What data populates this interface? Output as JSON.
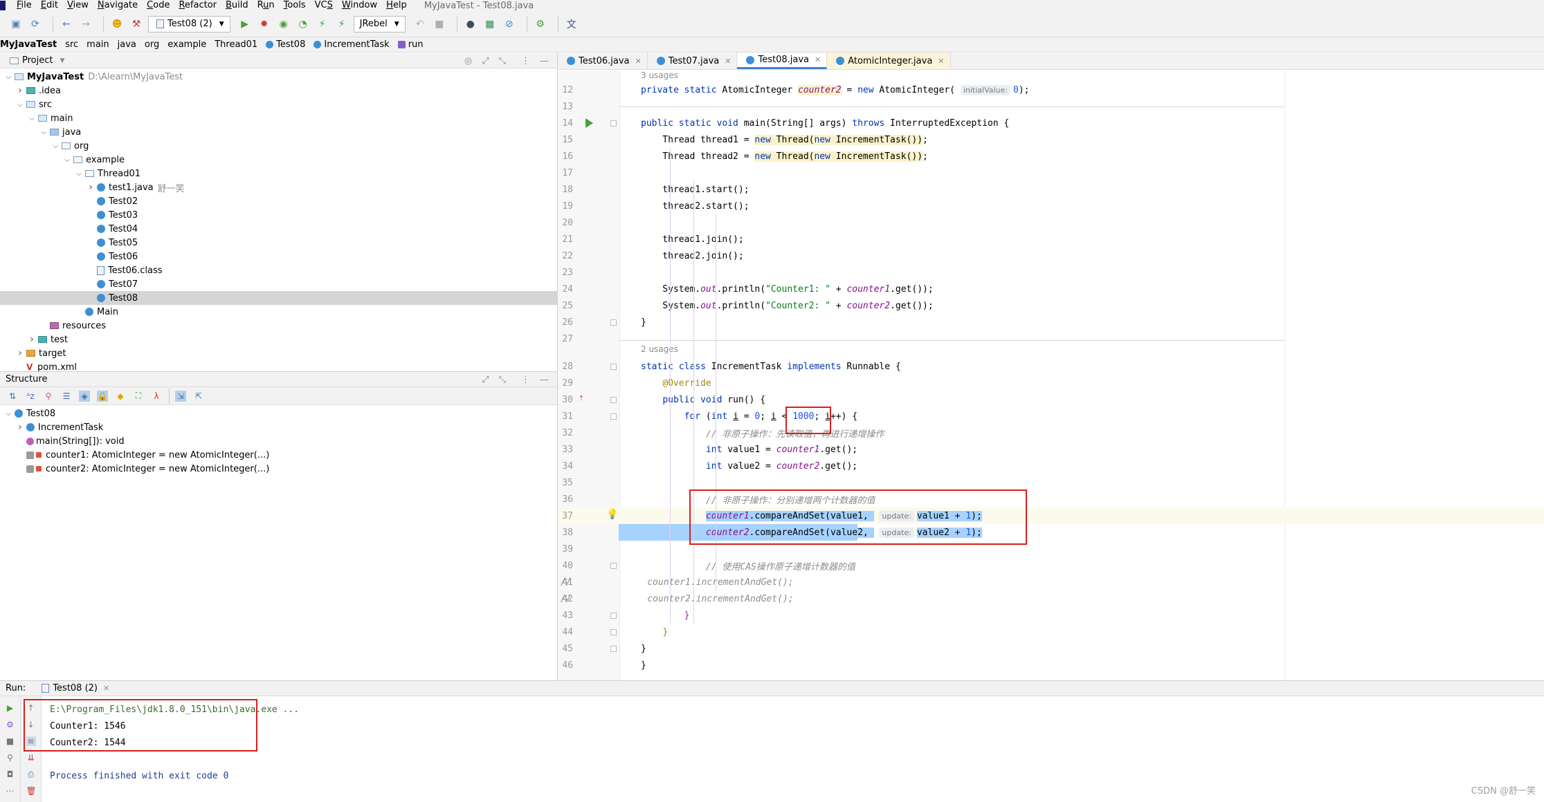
{
  "menubar": {
    "items": [
      "File",
      "Edit",
      "View",
      "Navigate",
      "Code",
      "Refactor",
      "Build",
      "Run",
      "Tools",
      "VCS",
      "Window",
      "Help"
    ],
    "mnemonics": [
      "F",
      "E",
      "V",
      "N",
      "C",
      "R",
      "B",
      "u",
      "T",
      "S",
      "W",
      "H"
    ],
    "window_title": "MyJavaTest - Test08.java"
  },
  "toolbar": {
    "run_config": "Test08 (2)",
    "jrebel": "JRebel"
  },
  "breadcrumb": [
    "MyJavaTest",
    "src",
    "main",
    "java",
    "org",
    "example",
    "Thread01",
    "Test08",
    "IncrementTask",
    "run"
  ],
  "project_panel": {
    "title": "Project",
    "tree": [
      {
        "label": "MyJavaTest",
        "extra": "D:\\Alearn\\MyJavaTest",
        "depth": 0,
        "toggle": "open",
        "icon": "folder",
        "bold": true
      },
      {
        "label": ".idea",
        "depth": 1,
        "toggle": "closed",
        "icon": "folder-teal"
      },
      {
        "label": "src",
        "depth": 1,
        "toggle": "open",
        "icon": "folder"
      },
      {
        "label": "main",
        "depth": 2,
        "toggle": "open",
        "icon": "folder"
      },
      {
        "label": "java",
        "depth": 3,
        "toggle": "open",
        "icon": "folder-src"
      },
      {
        "label": "org",
        "depth": 4,
        "toggle": "open",
        "icon": "folder-pkg"
      },
      {
        "label": "example",
        "depth": 5,
        "toggle": "open",
        "icon": "folder-pkg"
      },
      {
        "label": "Thread01",
        "depth": 6,
        "toggle": "open",
        "icon": "folder-pkg"
      },
      {
        "label": "test1.java",
        "extra": "舒一笑",
        "depth": 7,
        "toggle": "closed",
        "icon": "java"
      },
      {
        "label": "Test02",
        "depth": 7,
        "toggle": "",
        "icon": "java"
      },
      {
        "label": "Test03",
        "depth": 7,
        "toggle": "",
        "icon": "java"
      },
      {
        "label": "Test04",
        "depth": 7,
        "toggle": "",
        "icon": "java"
      },
      {
        "label": "Test05",
        "depth": 7,
        "toggle": "",
        "icon": "java"
      },
      {
        "label": "Test06",
        "depth": 7,
        "toggle": "",
        "icon": "java"
      },
      {
        "label": "Test06.class",
        "depth": 7,
        "toggle": "",
        "icon": "class"
      },
      {
        "label": "Test07",
        "depth": 7,
        "toggle": "",
        "icon": "java"
      },
      {
        "label": "Test08",
        "depth": 7,
        "toggle": "",
        "icon": "java",
        "selected": true
      },
      {
        "label": "Main",
        "depth": 6,
        "toggle": "",
        "icon": "java"
      },
      {
        "label": "resources",
        "depth": 3,
        "toggle": "",
        "icon": "folder-res"
      },
      {
        "label": "test",
        "depth": 2,
        "toggle": "closed",
        "icon": "folder-teal"
      },
      {
        "label": "target",
        "depth": 1,
        "toggle": "closed",
        "icon": "folder-orange"
      },
      {
        "label": "pom.xml",
        "depth": 1,
        "toggle": "",
        "icon": "xml"
      }
    ]
  },
  "structure_panel": {
    "title": "Structure",
    "items": [
      {
        "label": "Test08",
        "depth": 0,
        "toggle": "open",
        "icon": "class"
      },
      {
        "label": "IncrementTask",
        "depth": 1,
        "toggle": "closed",
        "icon": "class"
      },
      {
        "label": "main(String[]): void",
        "depth": 1,
        "toggle": "",
        "icon": "method"
      },
      {
        "label": "counter1: AtomicInteger = new AtomicInteger(...)",
        "depth": 1,
        "toggle": "",
        "icon": "field"
      },
      {
        "label": "counter2: AtomicInteger = new AtomicInteger(...)",
        "depth": 1,
        "toggle": "",
        "icon": "field"
      }
    ]
  },
  "editor": {
    "tabs": [
      {
        "label": "Test06.java",
        "active": false
      },
      {
        "label": "Test07.java",
        "active": false
      },
      {
        "label": "Test08.java",
        "active": true
      },
      {
        "label": "AtomicInteger.java",
        "active": false
      }
    ],
    "usages_1": "3 usages",
    "usages_2": "2 usages",
    "line_numbers": [
      "12",
      "13",
      "14",
      "15",
      "16",
      "17",
      "18",
      "19",
      "20",
      "21",
      "22",
      "23",
      "24",
      "25",
      "26",
      "27",
      "28",
      "29",
      "30",
      "31",
      "32",
      "33",
      "34",
      "35",
      "36",
      "37",
      "38",
      "39",
      "40",
      "41",
      "42",
      "43",
      "44",
      "45",
      "46"
    ],
    "inlay_initial_value": "initialValue:",
    "inlay_update": "update:",
    "comment_non_atomic": "// 非原子操作：先读取值，再进行递增操作",
    "comment_non_atomic_2": "// 非原子操作：分别递增两个计数器的值",
    "comment_cas": "// 使用CAS操作原子递增计数器的值",
    "loop_limit": "1000"
  },
  "run_panel": {
    "label": "Run:",
    "tab": "Test08 (2)",
    "console": [
      {
        "text": "E:\\Program_Files\\jdk1.8.0_151\\bin\\java.exe ...",
        "kind": "cmd"
      },
      {
        "text": "Counter1: 1546",
        "kind": "out"
      },
      {
        "text": "Counter2: 1544",
        "kind": "out"
      },
      {
        "text": "",
        "kind": "out"
      },
      {
        "text": "Process finished with exit code 0",
        "kind": "exit"
      }
    ]
  },
  "watermark": "CSDN @舒一笑"
}
